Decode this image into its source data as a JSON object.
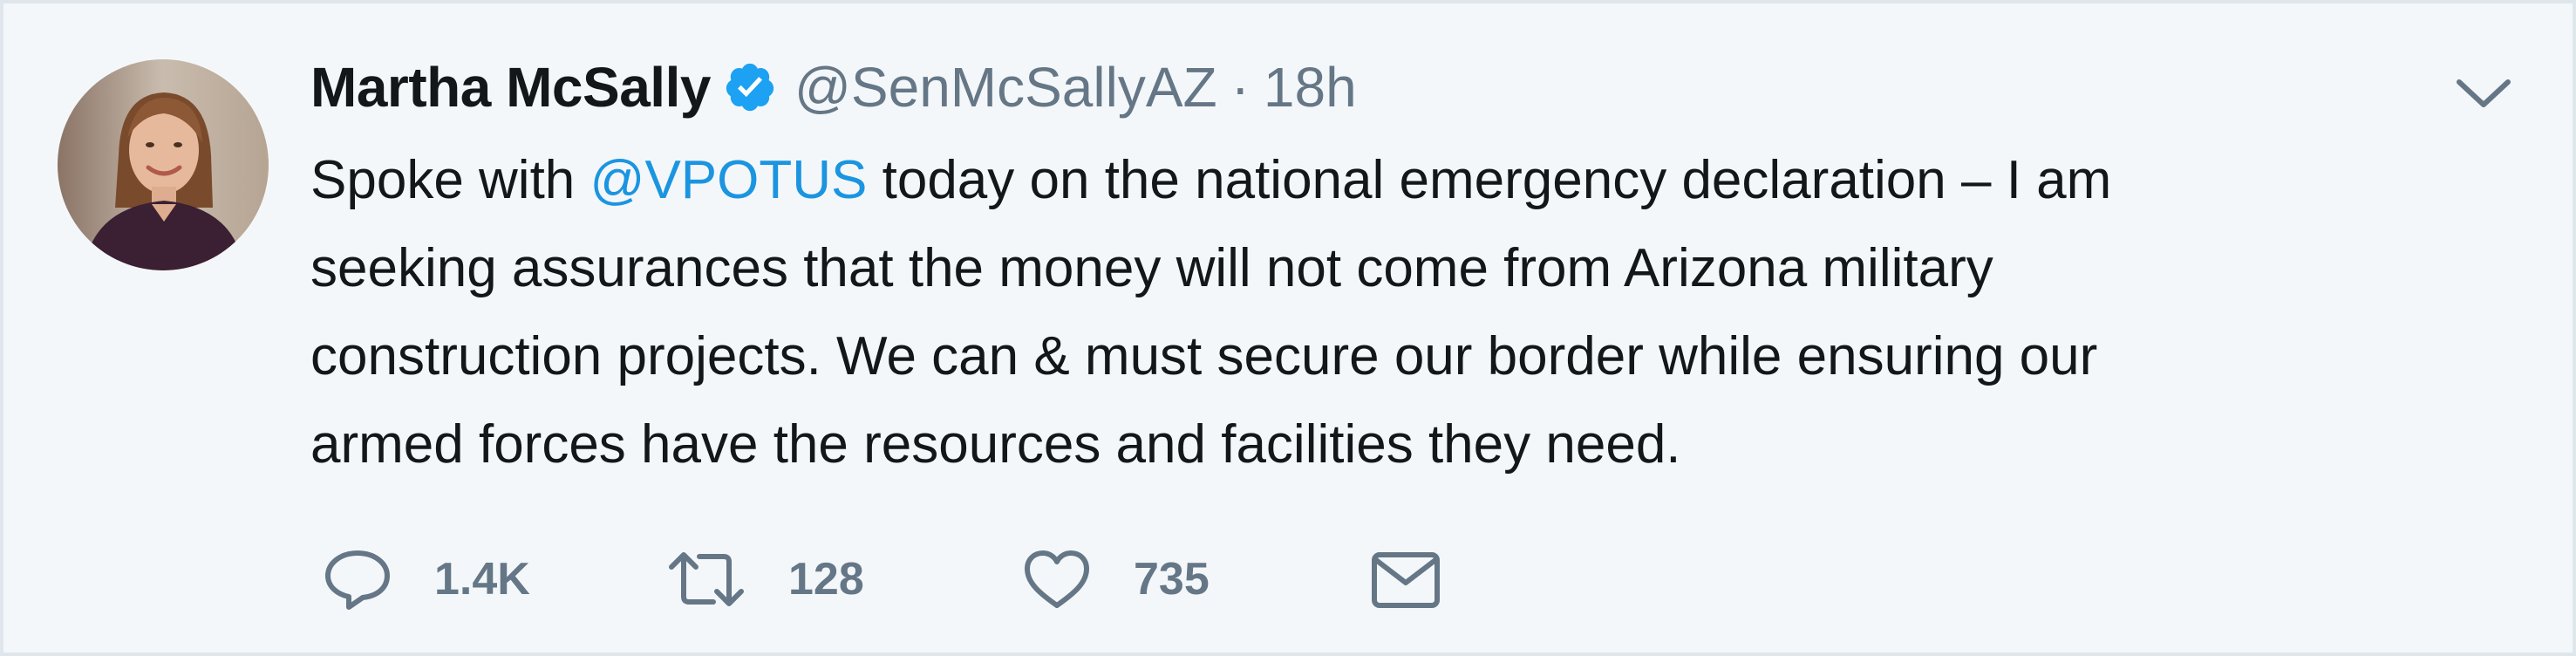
{
  "author": {
    "display_name": "Martha McSally",
    "handle": "@SenMcSallyAZ",
    "separator": "·",
    "timestamp": "18h",
    "verified": true
  },
  "tweet": {
    "lines": [
      {
        "before": "Spoke with ",
        "mention": "@VPOTUS",
        "after": " today on the national emergency declaration – I am"
      },
      {
        "text": "seeking assurances that the money will not come from Arizona military"
      },
      {
        "text": "construction projects. We can & must secure our border while ensuring our"
      },
      {
        "text": "armed forces have the resources and facilities they need."
      }
    ]
  },
  "actions": {
    "reply_count": "1.4K",
    "retweet_count": "128",
    "like_count": "735"
  },
  "icons": {
    "verified": "verified-badge-icon",
    "menu": "chevron-down-icon",
    "reply": "reply-icon",
    "retweet": "retweet-icon",
    "like": "heart-icon",
    "dm": "envelope-icon"
  },
  "colors": {
    "background": "#f4f7fa",
    "text": "#14171a",
    "secondary": "#657786",
    "mention": "#1b95e0",
    "verified": "#1da1f2"
  }
}
